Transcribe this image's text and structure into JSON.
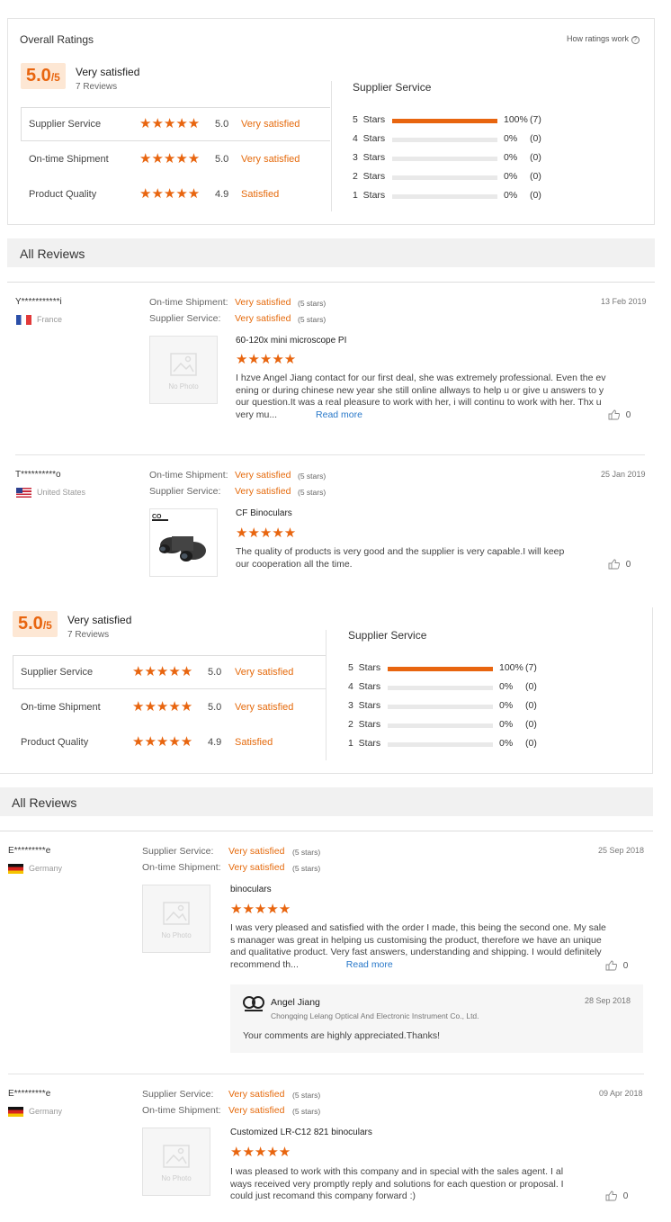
{
  "overall": {
    "title": "Overall Ratings",
    "how_link": "How ratings work",
    "score": "5.0",
    "score_suffix": "/5",
    "verdict": "Very satisfied",
    "reviews_count": "7 Reviews",
    "categories": [
      {
        "label": "Supplier Service",
        "stars": "★★★★★",
        "score": "5.0",
        "verdict": "Very satisfied"
      },
      {
        "label": "On-time Shipment",
        "stars": "★★★★★",
        "score": "5.0",
        "verdict": "Very satisfied"
      },
      {
        "label": "Product Quality",
        "stars": "★★★★★",
        "score": "4.9",
        "verdict": "Satisfied"
      }
    ],
    "breakdown_title": "Supplier Service",
    "breakdown": [
      {
        "label": "5  Stars",
        "percent": "100%",
        "count": "(7)",
        "fill": 1.0
      },
      {
        "label": "4  Stars",
        "percent": "0%",
        "count": "(0)",
        "fill": 0
      },
      {
        "label": "3  Stars",
        "percent": "0%",
        "count": "(0)",
        "fill": 0
      },
      {
        "label": "2  Stars",
        "percent": "0%",
        "count": "(0)",
        "fill": 0
      },
      {
        "label": "1  Stars",
        "percent": "0%",
        "count": "(0)",
        "fill": 0
      }
    ]
  },
  "all_reviews_label": "All Reviews",
  "reviews_a": [
    {
      "user": "Y***********i",
      "country": "France",
      "date": "13 Feb 2019",
      "rating1_label": "On-time Shipment:",
      "rating1_value": "Very satisfied",
      "rating1_stars": "(5 stars)",
      "rating2_label": "Supplier Service:",
      "rating2_value": "Very satisfied",
      "rating2_stars": "(5 stars)",
      "product": "60-120x mini microscope PI",
      "stars": "★★★★★",
      "text": "I hzve Angel Jiang contact for our first deal, she was extremely professional. Even the evening or during chinese new year she still online allways to help u or give u answers to your question.It was a real pleasure to work with her, i will continu to work with her. Thx u very mu...",
      "read_more": "Read more",
      "likes": "0",
      "photo": "No Photo"
    },
    {
      "user": "T**********o",
      "country": "United States",
      "date": "25 Jan 2019",
      "rating1_label": "On-time Shipment:",
      "rating1_value": "Very satisfied",
      "rating1_stars": "(5 stars)",
      "rating2_label": "Supplier Service:",
      "rating2_value": "Very satisfied",
      "rating2_stars": "(5 stars)",
      "product": "CF Binoculars",
      "stars": "★★★★★",
      "text": "The quality of products is very good and the supplier is very capable.I will keep our cooperation all the time.",
      "likes": "0"
    }
  ],
  "reviews_b": [
    {
      "user": "E*********e",
      "country": "Germany",
      "date": "25 Sep 2018",
      "rating1_label": "Supplier Service:",
      "rating1_value": "Very satisfied",
      "rating1_stars": "(5 stars)",
      "rating2_label": "On-time Shipment:",
      "rating2_value": "Very satisfied",
      "rating2_stars": "(5 stars)",
      "product": "binoculars",
      "stars": "★★★★★",
      "text": "I was very pleased and satisfied with the order I made, this being the second one. My sales manager was great in helping us customising the product, therefore we have an unique and qualitative product. Very fast answers, understanding and shipping. I would definitely recommend th...",
      "read_more": "Read more",
      "likes": "0",
      "photo": "No Photo",
      "reply": {
        "name": "Angel Jiang",
        "company": "Chongqing Lelang Optical And Electronic Instrument Co., Ltd.",
        "date": "28 Sep 2018",
        "text": "Your comments are highly appreciated.Thanks!"
      }
    },
    {
      "user": "E*********e",
      "country": "Germany",
      "date": "09 Apr 2018",
      "rating1_label": "Supplier Service:",
      "rating1_value": "Very satisfied",
      "rating1_stars": "(5 stars)",
      "rating2_label": "On-time Shipment:",
      "rating2_value": "Very satisfied",
      "rating2_stars": "(5 stars)",
      "product": "Customized LR-C12 821 binoculars",
      "stars": "★★★★★",
      "text": "I was pleased to work with this company and in special with the sales agent. I always received very promptly reply and solutions for each question or proposal. I could just recomand this company forward :)",
      "likes": "0",
      "photo": "No Photo"
    }
  ],
  "colors": {
    "accent": "#e8650f",
    "score_bg": "#fde7d4",
    "section_bg": "#f1f1f1"
  },
  "icons": [
    "help-icon",
    "thumbs-up-icon",
    "no-photo-icon",
    "company-logo-icon",
    "flag-france-icon",
    "flag-us-icon",
    "flag-germany-icon"
  ]
}
